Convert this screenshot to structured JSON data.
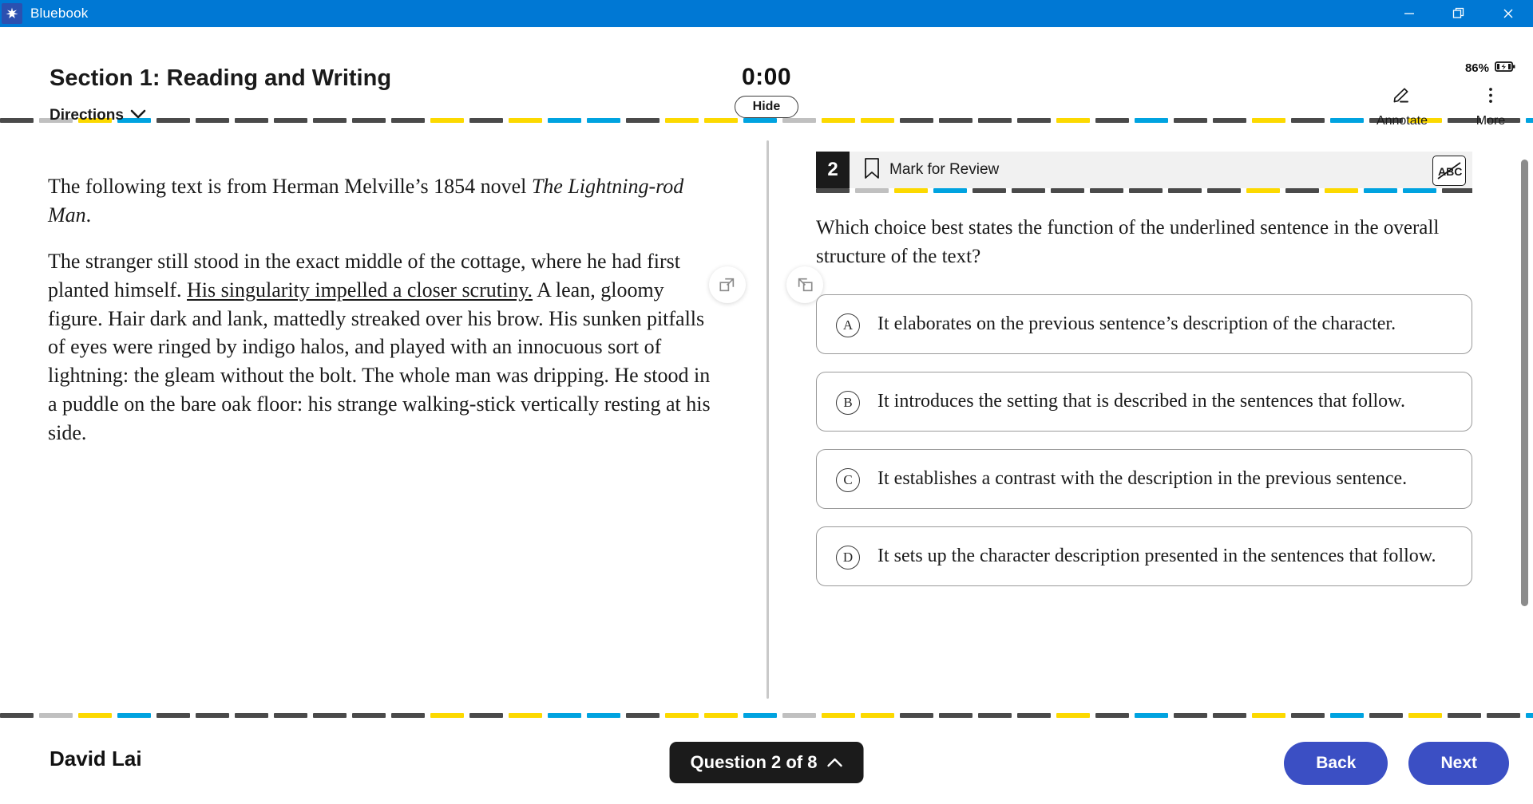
{
  "titlebar": {
    "app_name": "Bluebook",
    "logo_icon": "bluebook-star-icon",
    "minimize_icon": "minimize-icon",
    "maximize_icon": "maximize-icon",
    "close_icon": "close-icon"
  },
  "header": {
    "section_title": "Section 1: Reading and Writing",
    "directions_label": "Directions",
    "directions_chevron": "chevron-down-icon",
    "timer": "0:00",
    "hide_label": "Hide",
    "battery_percent": "86%",
    "battery_icon": "battery-charging-icon",
    "tools": [
      {
        "label": "Annotate",
        "icon": "pencil-annotate-icon"
      },
      {
        "label": "More",
        "icon": "more-vertical-icon"
      }
    ]
  },
  "passage": {
    "intro": "The following text is from Herman Melville’s 1854 novel ",
    "intro_title": "The Lightning-rod Man",
    "intro_end": ".",
    "body_1": "The stranger still stood in the exact middle of the cottage, where he had first planted himself. ",
    "body_underlined": "His singularity impelled a closer scrutiny.",
    "body_2": " A lean, gloomy figure. Hair dark and lank, mattedly streaked over his brow. His sunken pitfalls of eyes were ringed by indigo halos, and played with an innocuous sort of lightning: the gleam without the bolt. The whole man was dripping. He stood in a puddle on the bare oak floor: his strange walking-stick vertically resting at his side."
  },
  "panes": {
    "collapse_left_icon": "expand-right-panel-icon",
    "collapse_right_icon": "expand-left-panel-icon"
  },
  "question": {
    "number": "2",
    "bookmark_icon": "bookmark-icon",
    "mark_for_review": "Mark for Review",
    "abc_icon": "abc-strikethrough-icon",
    "stem": "Which choice best states the function of the underlined sentence in the overall structure of the text?",
    "choices": [
      {
        "letter": "A",
        "text": "It elaborates on the previous sentence’s description of the character."
      },
      {
        "letter": "B",
        "text": "It introduces the setting that is described in the sentences that follow."
      },
      {
        "letter": "C",
        "text": "It establishes a contrast with the description in the previous sentence."
      },
      {
        "letter": "D",
        "text": "It sets up the character description presented in the sentences that follow."
      }
    ]
  },
  "footer": {
    "student_name": "David Lai",
    "question_nav": "Question 2 of 8",
    "question_nav_chevron": "chevron-up-icon",
    "back_label": "Back",
    "next_label": "Next"
  },
  "colors": {
    "titlebar": "#0078d4",
    "accent_button": "#3b4fc4",
    "badge": "#1b1b1b",
    "rule_dark": "#4a4a4a",
    "rule_gray": "#c0c0c0",
    "rule_yellow": "#fcd900",
    "rule_blue": "#00a3e0"
  },
  "rule_pattern": [
    "dark",
    "gray",
    "yellow",
    "blue",
    "dark",
    "dark",
    "dark",
    "dark",
    "dark",
    "dark",
    "dark",
    "yellow",
    "dark",
    "yellow",
    "blue",
    "blue",
    "dark",
    "yellow",
    "yellow",
    "blue",
    "gray",
    "yellow",
    "yellow",
    "dark",
    "dark",
    "dark",
    "dark",
    "yellow",
    "dark",
    "blue",
    "dark",
    "dark",
    "yellow",
    "dark",
    "blue",
    "dark",
    "yellow",
    "dark",
    "dark",
    "blue",
    "yellow",
    "dark",
    "dark",
    "gray",
    "dark",
    "yellow",
    "dark",
    "blue",
    "dark",
    "dark",
    "yellow",
    "dark",
    "dark",
    "dark"
  ]
}
